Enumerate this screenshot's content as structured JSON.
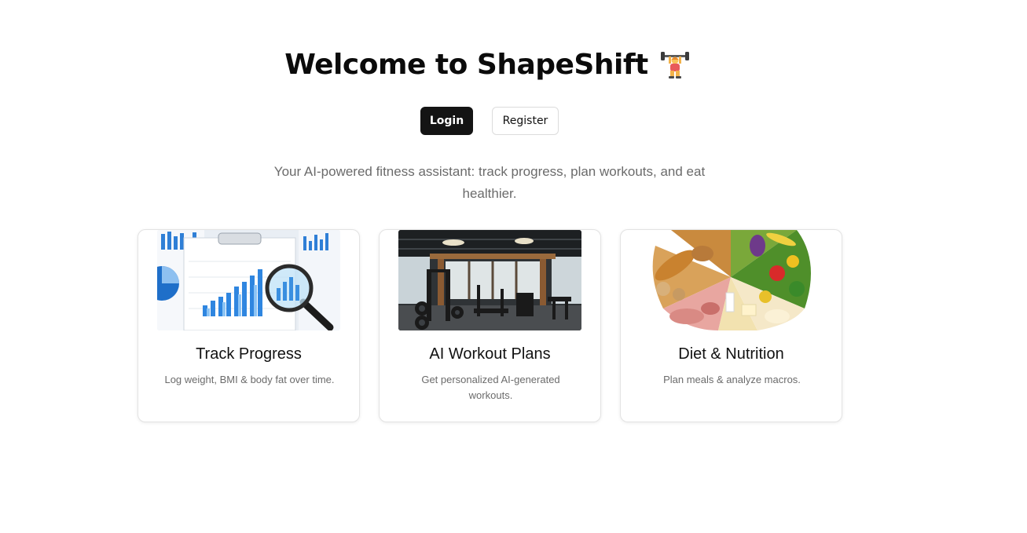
{
  "header": {
    "title": "Welcome to ShapeShift",
    "title_icon": "weightlifter-icon"
  },
  "actions": {
    "login_label": "Login",
    "register_label": "Register"
  },
  "tagline": "Your AI-powered fitness assistant: track progress, plan workouts, and eat healthier.",
  "features": [
    {
      "title": "Track Progress",
      "description": "Log weight, BMI & body fat over time.",
      "image": "charts-magnifier-image"
    },
    {
      "title": "AI Workout Plans",
      "description": "Get personalized AI-generated workouts.",
      "image": "gym-interior-image"
    },
    {
      "title": "Diet & Nutrition",
      "description": "Plan meals & analyze macros.",
      "image": "food-plate-image"
    }
  ],
  "colors": {
    "primary_button": "#141414",
    "muted_text": "#6b6b6b",
    "card_border": "#e3e3e3"
  }
}
